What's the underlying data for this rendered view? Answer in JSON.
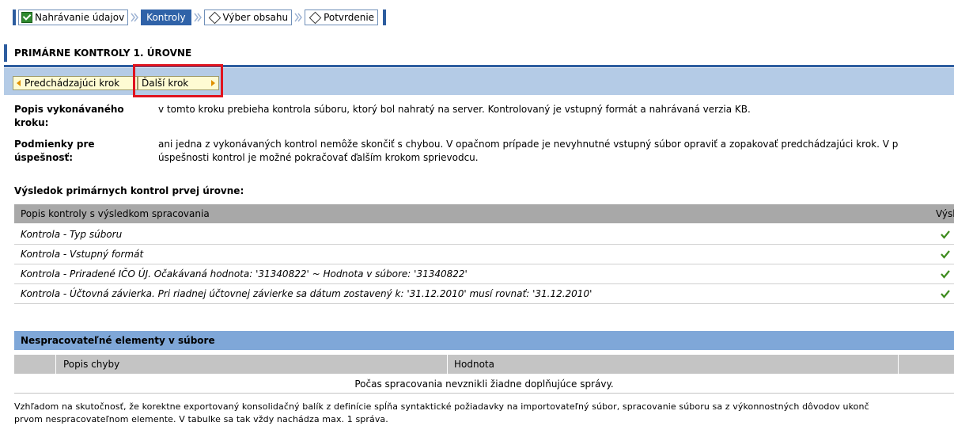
{
  "wizard": {
    "steps": [
      {
        "label": "Nahrávanie údajov",
        "state": "done"
      },
      {
        "label": "Kontroly",
        "state": "active"
      },
      {
        "label": "Výber obsahu",
        "state": "pending"
      },
      {
        "label": "Potvrdenie",
        "state": "pending"
      }
    ]
  },
  "section": {
    "title": "PRIMÁRNE KONTROLY 1. ÚROVNE",
    "prev_button": "Predchádzajúci krok",
    "next_button": "Ďalší krok"
  },
  "description": {
    "step_label_1": "Popis vykonávaného",
    "step_label_2": "kroku:",
    "step_text": "v tomto kroku prebieha kontrola súboru, ktorý bol nahratý na server. Kontrolovaný je vstupný formát a nahrávaná verzia KB.",
    "cond_label_1": "Podmienky pre",
    "cond_label_2": "úspešnosť:",
    "cond_text_1": "ani jedna z vykonávaných kontrol nemôže skončiť s chybou. V opačnom prípade je nevyhnutné vstupný súbor opraviť a zopakovať predchádzajúci krok. V p",
    "cond_text_2": "úspešnosti kontrol je možné pokračovať ďalším krokom sprievodcu."
  },
  "results": {
    "heading": "Výsledok primárnych kontrol prvej úrovne:",
    "col_desc": "Popis kontroly s výsledkom spracovania",
    "col_result": "Výsle",
    "rows": [
      {
        "text": "Kontrola - Typ súboru"
      },
      {
        "text": "Kontrola - Vstupný formát"
      },
      {
        "text": "Kontrola - Priradené IČO ÚJ. Očakávaná hodnota: '31340822' ~ Hodnota v súbore: '31340822'"
      },
      {
        "text": "Kontrola - Účtovná závierka. Pri riadnej účtovnej závierke sa dátum zostavený k: '31.12.2010' musí rovnať: '31.12.2010'"
      }
    ]
  },
  "unprocessed": {
    "heading": "Nespracovateľné elementy v súbore",
    "col_error": "Popis chyby",
    "col_value": "Hodnota",
    "empty_message": "Počas spracovania nevznikli žiadne doplňujúce správy."
  },
  "footnote": {
    "line_1": "Vzhľadom na skutočnosť, že korektne exportovaný konsolidačný balík z definície spĺňa syntaktické požiadavky na importovateľný súbor, spracovanie súboru sa z výkonnostných dôvodov ukonč",
    "line_2": "prvom nespracovateľnom elemente. V tabulke sa tak vždy nachádza max. 1 správa."
  },
  "colors": {
    "accent": "#2d5d9f",
    "nav_band": "#b4cbe6",
    "highlight": "#e0141e",
    "tick": "#3f8c1f"
  }
}
